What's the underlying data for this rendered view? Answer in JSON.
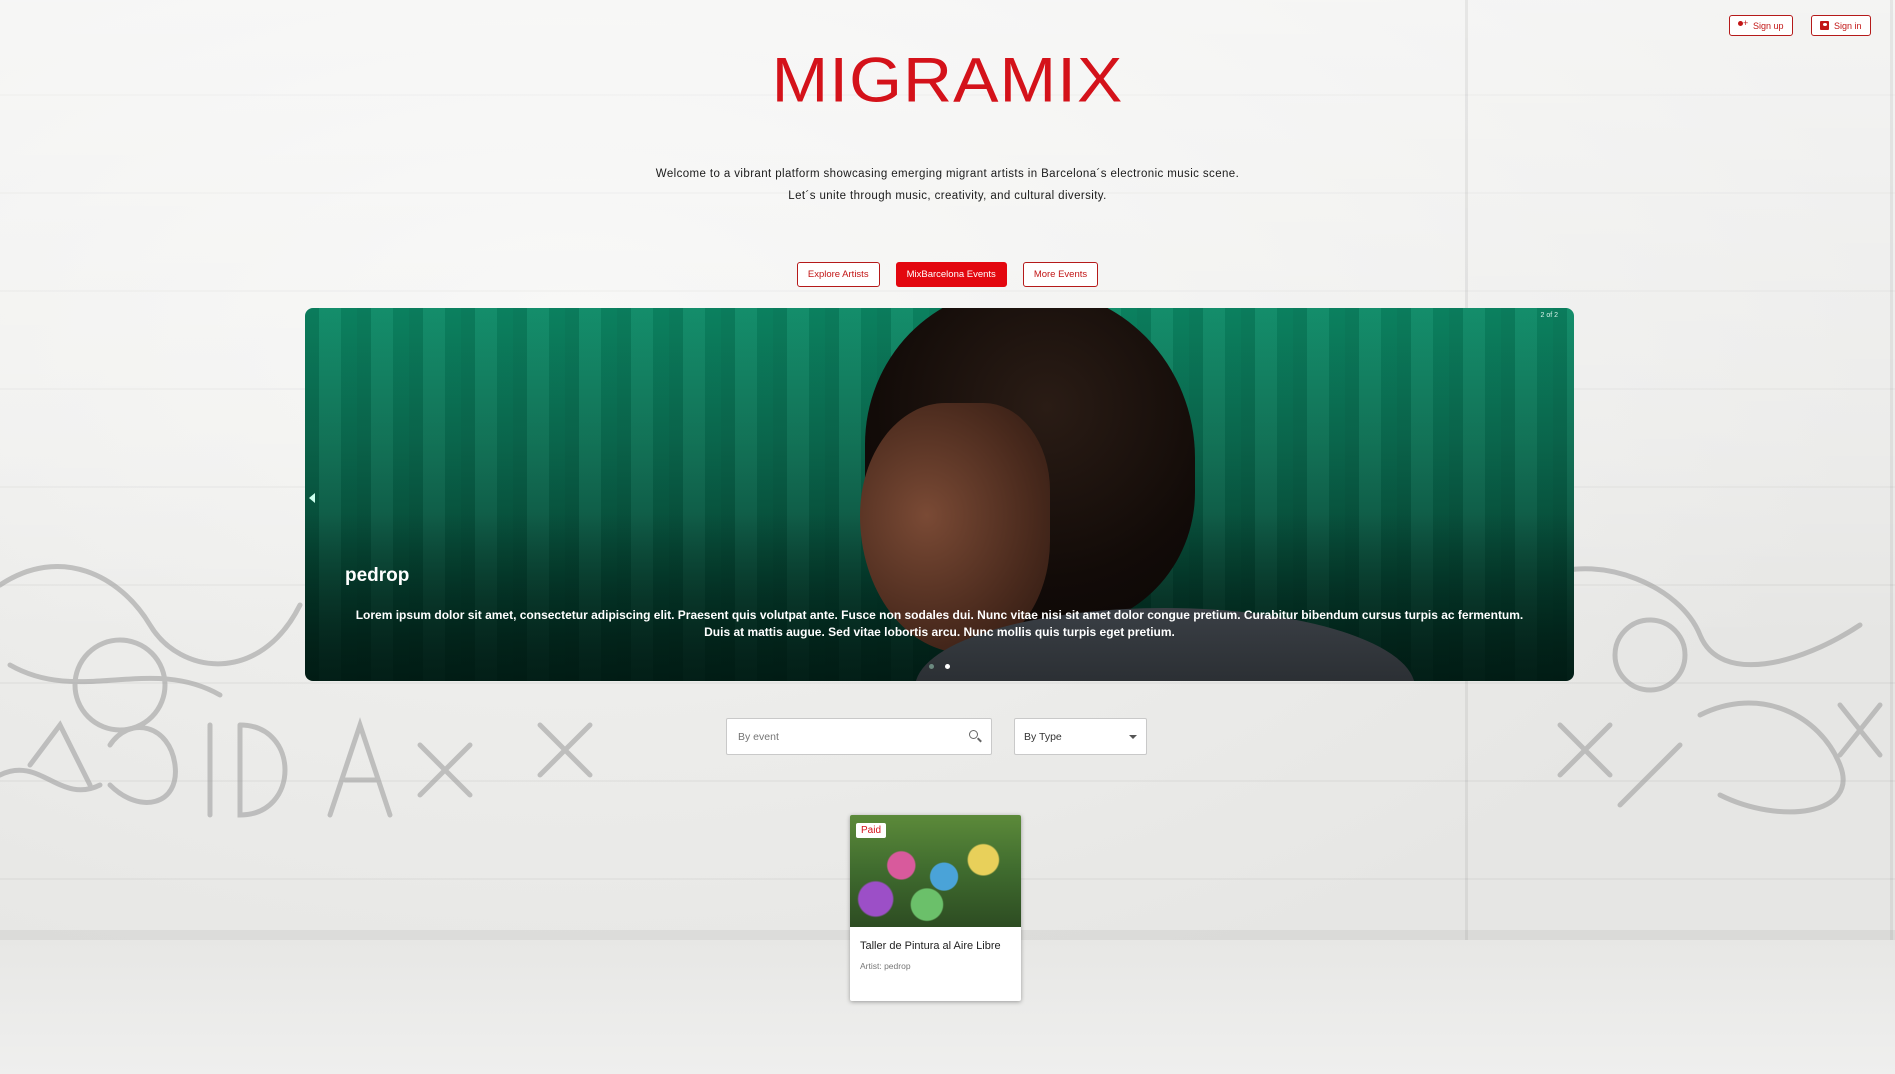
{
  "header": {
    "signup_label": "Sign up",
    "signin_label": "Sign in",
    "logo_text": "MIGRAMIX"
  },
  "intro": {
    "line1": "Welcome to a vibrant platform showcasing emerging migrant artists in Barcelona´s electronic music scene.",
    "line2": "Let´s unite through music, creativity, and cultural diversity."
  },
  "nav": {
    "items": [
      {
        "label": "Explore Artists",
        "active": false
      },
      {
        "label": "MixBarcelona Events",
        "active": true
      },
      {
        "label": "More Events",
        "active": false
      }
    ]
  },
  "carousel": {
    "counter": "2 of 2",
    "title": "pedrop",
    "text": "Lorem ipsum dolor sit amet, consectetur adipiscing elit. Praesent quis volutpat ante. Fusce non sodales dui. Nunc vitae nisi sit amet dolor congue pretium. Curabitur bibendum cursus turpis ac fermentum. Duis at mattis augue. Sed vitae lobortis arcu. Nunc mollis quis turpis eget pretium.",
    "active_slide": 2,
    "slide_count": 2
  },
  "filters": {
    "search_placeholder": "By event",
    "type_label": "By Type"
  },
  "events": [
    {
      "badge": "Paid",
      "title": "Taller de Pintura al Aire Libre",
      "artist": "Artist: pedrop"
    }
  ],
  "colors": {
    "brand_red": "#e3070f",
    "carousel_green": "#0b6e52"
  }
}
